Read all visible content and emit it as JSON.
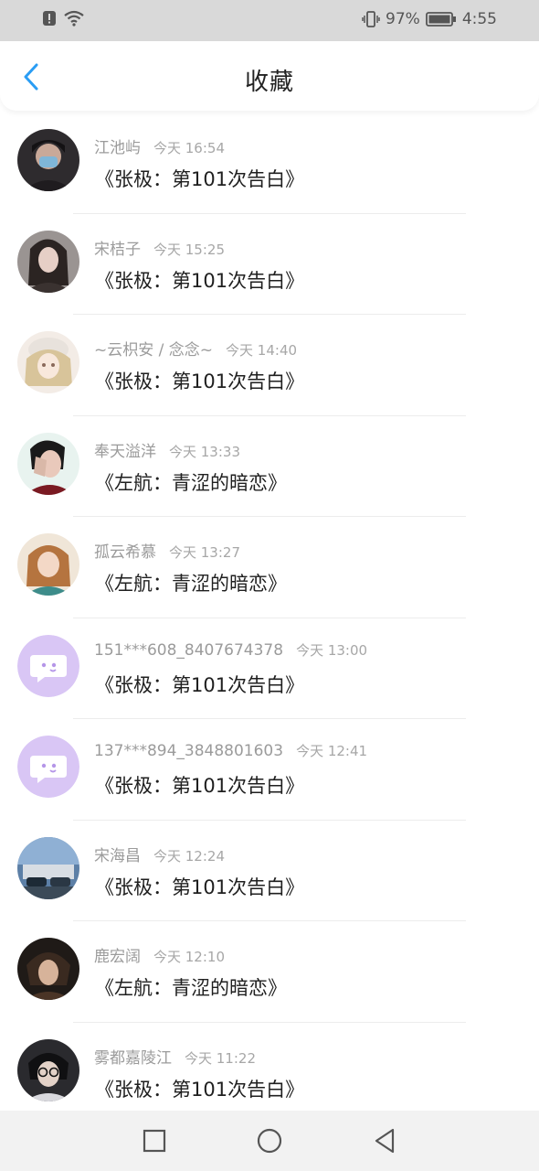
{
  "status_bar": {
    "battery_percent": "97%",
    "time": "4:55",
    "icons": [
      "notification-alert-icon",
      "wifi-icon",
      "vibrate-icon",
      "battery-icon"
    ]
  },
  "header": {
    "title": "收藏",
    "back_icon": "chevron-left-icon"
  },
  "items": [
    {
      "name": "江池屿",
      "time": "今天 16:54",
      "title": "《张极：第101次告白》",
      "avatar": "photo"
    },
    {
      "name": "宋桔子",
      "time": "今天 15:25",
      "title": "《张极：第101次告白》",
      "avatar": "photo"
    },
    {
      "name": "~云枳安 / 念念~",
      "time": "今天 14:40",
      "title": "《张极：第101次告白》",
      "avatar": "photo"
    },
    {
      "name": "奉天溢洋",
      "time": "今天 13:33",
      "title": "《左航：青涩的暗恋》",
      "avatar": "photo"
    },
    {
      "name": "孤云希慕",
      "time": "今天 13:27",
      "title": "《左航：青涩的暗恋》",
      "avatar": "photo"
    },
    {
      "name": "151***608_8407674378",
      "time": "今天 13:00",
      "title": "《张极：第101次告白》",
      "avatar": "default"
    },
    {
      "name": "137***894_3848801603",
      "time": "今天 12:41",
      "title": "《张极：第101次告白》",
      "avatar": "default"
    },
    {
      "name": "宋海昌",
      "time": "今天 12:24",
      "title": "《张极：第101次告白》",
      "avatar": "photo"
    },
    {
      "name": "鹿宏阔",
      "time": "今天 12:10",
      "title": "《左航：青涩的暗恋》",
      "avatar": "photo"
    },
    {
      "name": "雾都嘉陵江",
      "time": "今天 11:22",
      "title": "《张极：第101次告白》",
      "avatar": "photo"
    }
  ],
  "nav_bar": {
    "icons": [
      "recent-apps-square-icon",
      "home-circle-icon",
      "back-triangle-icon"
    ]
  },
  "colors": {
    "accent": "#2a9df4",
    "default_avatar_bg": "#d9c6f5"
  }
}
